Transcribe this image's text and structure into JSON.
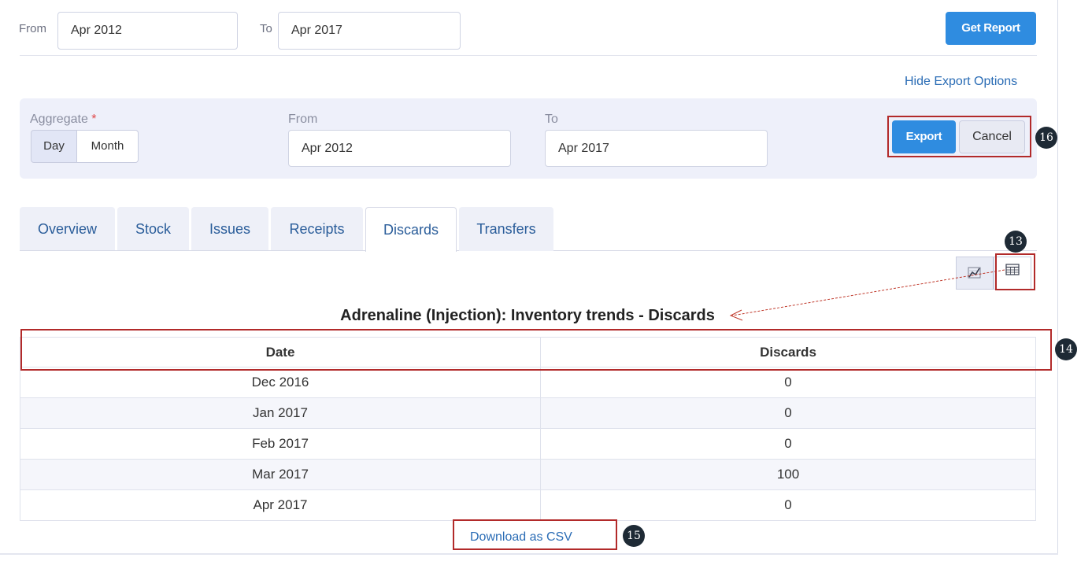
{
  "filter": {
    "from_label": "From",
    "from_value": "Apr 2012",
    "to_label": "To",
    "to_value": "Apr 2017",
    "get_report_label": "Get Report"
  },
  "hide_export_label": "Hide Export Options",
  "export": {
    "aggregate_label": "Aggregate",
    "required_mark": "*",
    "day_label": "Day",
    "month_label": "Month",
    "from_label": "From",
    "from_value": "Apr 2012",
    "to_label": "To",
    "to_value": "Apr 2017",
    "export_label": "Export",
    "cancel_label": "Cancel"
  },
  "tabs": [
    {
      "label": "Overview"
    },
    {
      "label": "Stock"
    },
    {
      "label": "Issues"
    },
    {
      "label": "Receipts"
    },
    {
      "label": "Discards"
    },
    {
      "label": "Transfers"
    }
  ],
  "active_tab": "Discards",
  "view_icons": {
    "chart": "chart-icon",
    "table": "table-icon"
  },
  "table_title": "Adrenaline (Injection): Inventory trends - Discards",
  "table": {
    "headers": [
      "Date",
      "Discards"
    ],
    "rows": [
      [
        "Dec 2016",
        "0"
      ],
      [
        "Jan 2017",
        "0"
      ],
      [
        "Feb 2017",
        "0"
      ],
      [
        "Mar 2017",
        "100"
      ],
      [
        "Apr 2017",
        "0"
      ]
    ]
  },
  "download_label": "Download as CSV",
  "callouts": [
    "13",
    "14",
    "15",
    "16"
  ],
  "colors": {
    "primary": "#2f8ce0",
    "callout_border": "#b22a2a",
    "badge": "#1e2a35",
    "panel_bg": "#eef0fa",
    "link": "#2a6cb5"
  }
}
